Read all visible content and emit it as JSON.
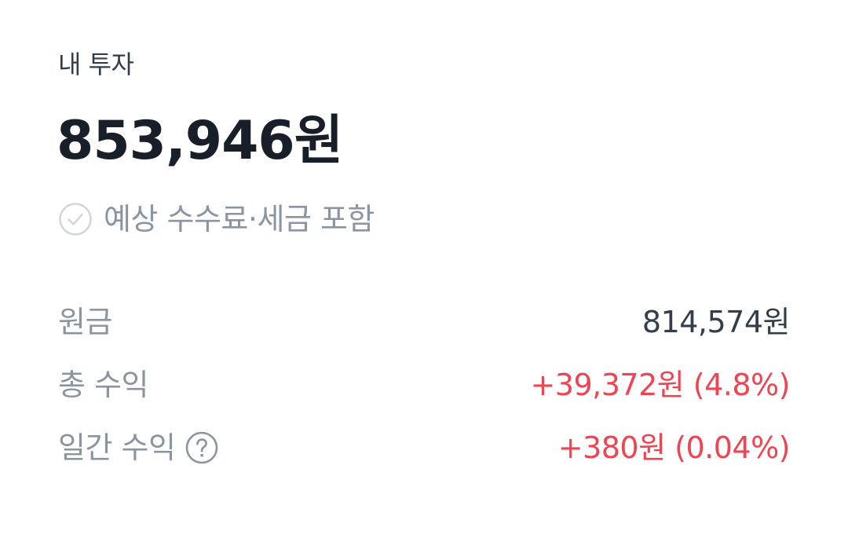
{
  "investment": {
    "section_title": "내 투자",
    "total_amount": "853,946원",
    "fee_note": "예상 수수료·세금 포함",
    "fee_included_checked": true,
    "rows": [
      {
        "label": "원금",
        "value": "814,574원",
        "status": "neutral"
      },
      {
        "label": "총 수익",
        "value": "+39,372원 (4.8%)",
        "status": "positive"
      },
      {
        "label": "일간 수익",
        "value": "+380원 (0.04%)",
        "status": "positive",
        "help_icon": "question-circle-icon"
      }
    ]
  },
  "colors": {
    "text_primary": "#191f28",
    "text_secondary": "#8b95a1",
    "value_neutral": "#333d4b",
    "profit_red": "#f04452",
    "icon_outline": "#d1d6db"
  },
  "icons": {
    "fee_check": "check-circle-icon",
    "daily_help": "question-circle-icon"
  }
}
